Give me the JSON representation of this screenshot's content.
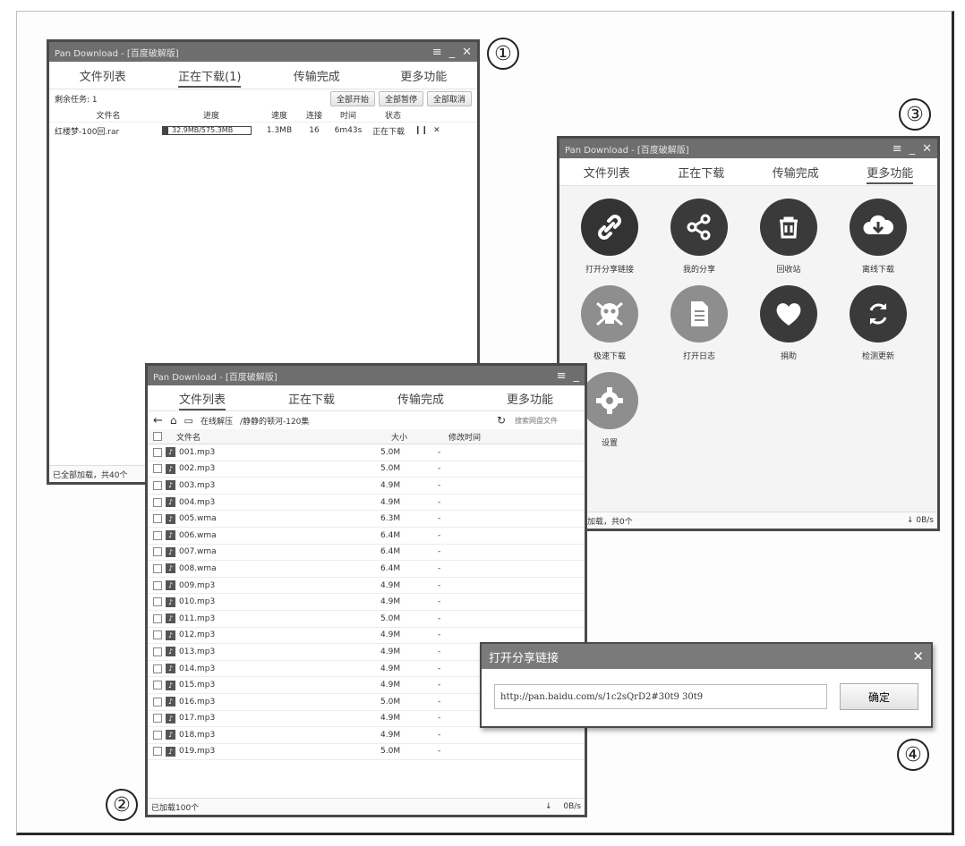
{
  "callouts": [
    "①",
    "②",
    "③",
    "④"
  ],
  "colors": {
    "titlebar": "#6e6e6e",
    "dark_icon": "#3a3a3a",
    "gray_icon": "#8e8e8e"
  },
  "win1": {
    "title": "Pan Download - [百度破解版]",
    "tabs": [
      "文件列表",
      "正在下载(1)",
      "传输完成",
      "更多功能"
    ],
    "remaining": "剩余任务: 1",
    "buttons": [
      "全部开始",
      "全部暂停",
      "全部取消"
    ],
    "headers": [
      "文件名",
      "进度",
      "速度",
      "连接",
      "时间",
      "状态"
    ],
    "row": {
      "name": "红楼梦-100回.rar",
      "progress": "32.9MB/575.3MB",
      "progress_fraction": 0.06,
      "speed": "1.3MB",
      "conn": "16",
      "time": "6m43s",
      "status": "正在下载"
    },
    "status": "已全部加载，共40个"
  },
  "win2": {
    "title": "Pan Download - [百度破解版]",
    "tabs": [
      "文件列表",
      "正在下载",
      "传输完成",
      "更多功能"
    ],
    "location": "在线解压",
    "path": "/静静的顿河-120集",
    "search_placeholder": "搜索网盘文件",
    "headers": [
      "文件名",
      "大小",
      "修改时间"
    ],
    "files": [
      {
        "name": "001.mp3",
        "size": "5.0M",
        "time": "-"
      },
      {
        "name": "002.mp3",
        "size": "5.0M",
        "time": "-"
      },
      {
        "name": "003.mp3",
        "size": "4.9M",
        "time": "-"
      },
      {
        "name": "004.mp3",
        "size": "4.9M",
        "time": "-"
      },
      {
        "name": "005.wma",
        "size": "6.3M",
        "time": "-"
      },
      {
        "name": "006.wma",
        "size": "6.4M",
        "time": "-"
      },
      {
        "name": "007.wma",
        "size": "6.4M",
        "time": "-"
      },
      {
        "name": "008.wma",
        "size": "6.4M",
        "time": "-"
      },
      {
        "name": "009.mp3",
        "size": "4.9M",
        "time": "-"
      },
      {
        "name": "010.mp3",
        "size": "4.9M",
        "time": "-"
      },
      {
        "name": "011.mp3",
        "size": "5.0M",
        "time": "-"
      },
      {
        "name": "012.mp3",
        "size": "4.9M",
        "time": "-"
      },
      {
        "name": "013.mp3",
        "size": "4.9M",
        "time": "-"
      },
      {
        "name": "014.mp3",
        "size": "4.9M",
        "time": "-"
      },
      {
        "name": "015.mp3",
        "size": "4.9M",
        "time": "-"
      },
      {
        "name": "016.mp3",
        "size": "5.0M",
        "time": "-"
      },
      {
        "name": "017.mp3",
        "size": "4.9M",
        "time": "-"
      },
      {
        "name": "018.mp3",
        "size": "4.9M",
        "time": "-"
      },
      {
        "name": "019.mp3",
        "size": "5.0M",
        "time": "-"
      }
    ],
    "status": "已加载100个",
    "speed": "0B/s"
  },
  "win3": {
    "title": "Pan Download - [百度破解版]",
    "tabs": [
      "文件列表",
      "正在下载",
      "传输完成",
      "更多功能"
    ],
    "features": [
      {
        "label": "打开分享链接",
        "icon": "link-icon"
      },
      {
        "label": "我的分享",
        "icon": "share-icon"
      },
      {
        "label": "回收站",
        "icon": "trash-icon"
      },
      {
        "label": "离线下载",
        "icon": "cloud-download-icon"
      },
      {
        "label": "极速下载",
        "icon": "skull-icon"
      },
      {
        "label": "打开日志",
        "icon": "document-icon"
      },
      {
        "label": "捐助",
        "icon": "heart-icon"
      },
      {
        "label": "检测更新",
        "icon": "refresh-icon"
      },
      {
        "label": "设置",
        "icon": "gear-icon"
      }
    ],
    "status": "已全部加载，共0个",
    "speed": "0B/s"
  },
  "dialog": {
    "title": "打开分享链接",
    "url": "http://pan.baidu.com/s/1c2sQrD2#30t9 30t9",
    "ok": "确定"
  }
}
